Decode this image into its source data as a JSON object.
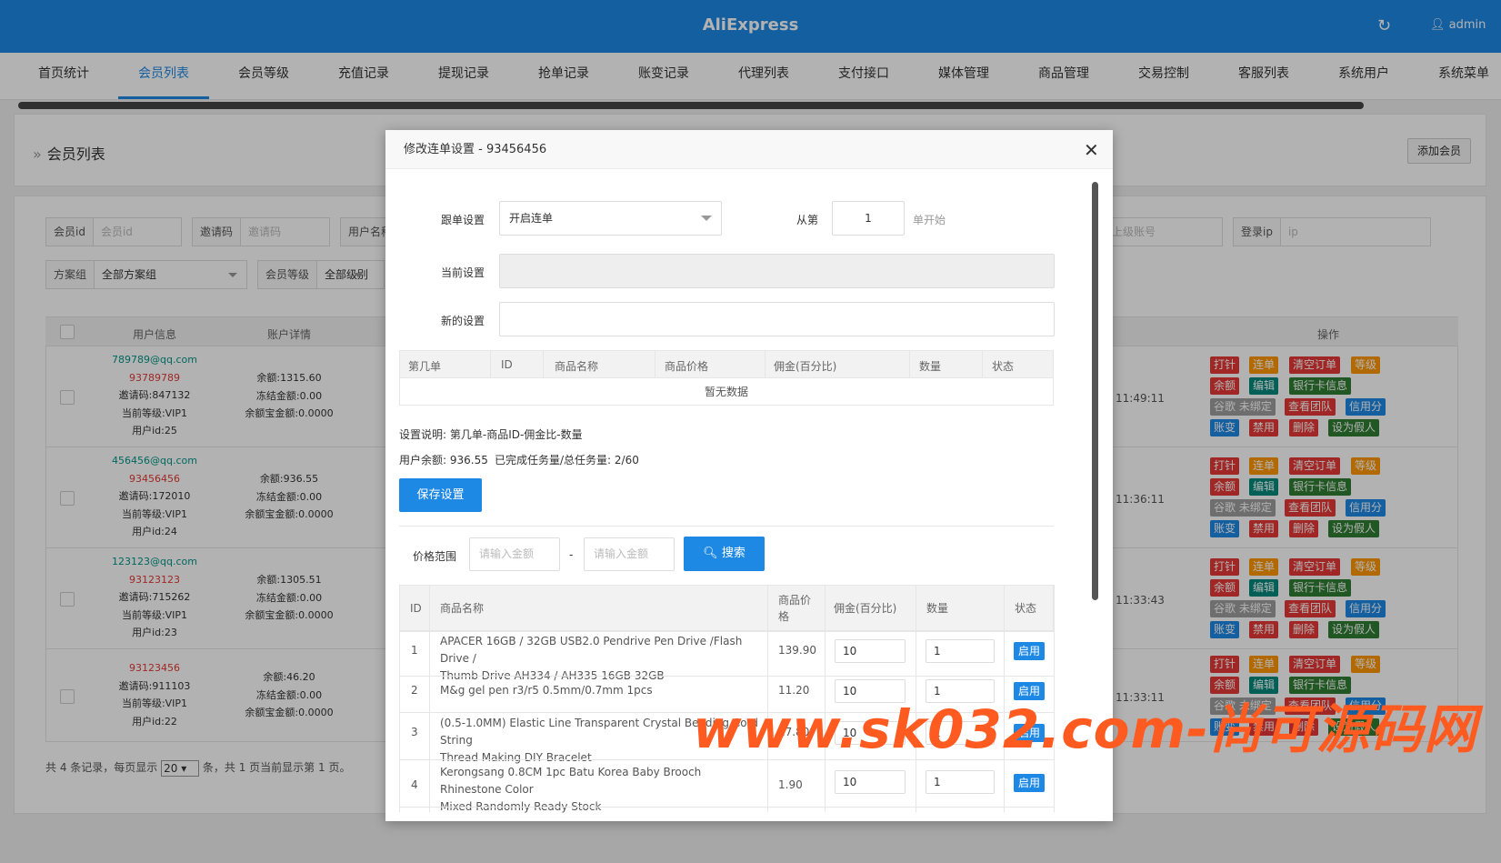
{
  "app": {
    "title": "AliExpress",
    "user": "admin"
  },
  "nav": [
    "首页统计",
    "会员列表",
    "会员等级",
    "充值记录",
    "提现记录",
    "抢单记录",
    "账变记录",
    "代理列表",
    "支付接口",
    "媒体管理",
    "商品管理",
    "交易控制",
    "客服列表",
    "系统用户",
    "系统菜单"
  ],
  "page": {
    "title": "会员列表",
    "add_label": "添加会员"
  },
  "filters": {
    "member_id": {
      "label": "会员id",
      "placeholder": "会员id"
    },
    "invite": {
      "label": "邀请码",
      "placeholder": "邀请码"
    },
    "username": {
      "label": "用户名称"
    },
    "parent": {
      "placeholder": "上级账号"
    },
    "login_ip": {
      "label": "登录ip",
      "placeholder": "ip"
    },
    "plan": {
      "label": "方案组",
      "value": "全部方案组"
    },
    "level": {
      "label": "会员等级",
      "value": "全部级别"
    }
  },
  "table": {
    "headers": {
      "user": "用户信息",
      "account": "账户详情",
      "ops": "操作"
    },
    "rows": [
      {
        "email": "789789@qq.com",
        "phone": "93789789",
        "invite": "邀请码:847132",
        "level": "当前等级:VIP1",
        "uid": "用户id:25",
        "balance": "余额:1315.60",
        "frozen": "冻结金额:0.00",
        "bao": "余额宝金额:0.0000",
        "time": "11:49:11"
      },
      {
        "email": "456456@qq.com",
        "phone": "93456456",
        "invite": "邀请码:172010",
        "level": "当前等级:VIP1",
        "uid": "用户id:24",
        "balance": "余额:936.55",
        "frozen": "冻结金额:0.00",
        "bao": "余额宝金额:0.0000",
        "time": "11:36:11"
      },
      {
        "email": "123123@qq.com",
        "phone": "93123123",
        "invite": "邀请码:715262",
        "level": "当前等级:VIP1",
        "uid": "用户id:23",
        "balance": "余额:1305.51",
        "frozen": "冻结金额:0.00",
        "bao": "余额宝金额:0.0000",
        "time": "11:33:43"
      },
      {
        "email": "",
        "phone": "93123456",
        "invite": "邀请码:911103",
        "level": "当前等级:VIP1",
        "uid": "用户id:22",
        "balance": "余额:46.20",
        "frozen": "冻结金额:0.00",
        "bao": "余额宝金额:0.0000",
        "time": "11:33:11"
      }
    ],
    "ops": [
      "打针",
      "连单",
      "清空订单",
      "等级",
      "余额",
      "编辑",
      "银行卡信息",
      "谷歌 未绑定",
      "查看团队",
      "信用分",
      "账变",
      "禁用",
      "删除",
      "设为假人"
    ],
    "pager": {
      "prefix": "共 4 条记录，每页显示",
      "per_page": "20",
      "suffix": "条，共 1 页当前显示第 1 页。"
    }
  },
  "modal": {
    "title": "修改连单设置 - 93456456",
    "follow_label": "跟单设置",
    "follow_value": "开启连单",
    "from_label": "从第",
    "from_value": "1",
    "from_suffix": "单开始",
    "current_label": "当前设置",
    "new_label": "新的设置",
    "setting_headers": [
      "第几单",
      "ID",
      "商品名称",
      "商品价格",
      "佣金(百分比)",
      "数量",
      "状态"
    ],
    "no_data": "暂无数据",
    "desc": "设置说明: 第几单-商品ID-佣金比-数量",
    "balance_info": "用户余额: 936.55",
    "task_info": "已完成任务量/总任务量: 2/60",
    "save_label": "保存设置",
    "price_label": "价格范围",
    "price_min_placeholder": "请输入金额",
    "price_max_placeholder": "请输入金额",
    "search_label": "搜索",
    "product_headers": {
      "id": "ID",
      "name": "商品名称",
      "price_a": "商品价",
      "price_b": "格",
      "commission": "佣金(百分比)",
      "qty": "数量",
      "status": "状态"
    },
    "products": [
      {
        "id": "1",
        "name1": "APACER 16GB / 32GB USB2.0 Pendrive Pen Drive /Flash Drive /",
        "name2": "Thumb Drive AH334 / AH335 16GB 32GB",
        "price": "139.90",
        "commission": "10",
        "qty": "1",
        "status": "启用"
      },
      {
        "id": "2",
        "name1": "M&g gel pen r3/r5 0.5mm/0.7mm 1pcs",
        "name2": "",
        "price": "11.20",
        "commission": "10",
        "qty": "1",
        "status": "启用"
      },
      {
        "id": "3",
        "name1": "(0.5-1.0MM) Elastic Line Transparent Crystal Beading Cord String",
        "name2": "Thread Making DIY Bracelet",
        "price": "27.80",
        "commission": "10",
        "qty": "1",
        "status": "启用"
      },
      {
        "id": "4",
        "name1": "Kerongsang 0.8CM 1pc Batu Korea Baby Brooch Rhinestone Color",
        "name2": "Mixed Randomly Ready Stock",
        "price": "1.90",
        "commission": "10",
        "qty": "1",
        "status": "启用"
      }
    ]
  },
  "watermark": "www.sk032.com-尚可源码网",
  "colors": {
    "primary": "#1e88e5",
    "brand_bar": "#1e88e5",
    "watermark": "#ff5a1f"
  }
}
